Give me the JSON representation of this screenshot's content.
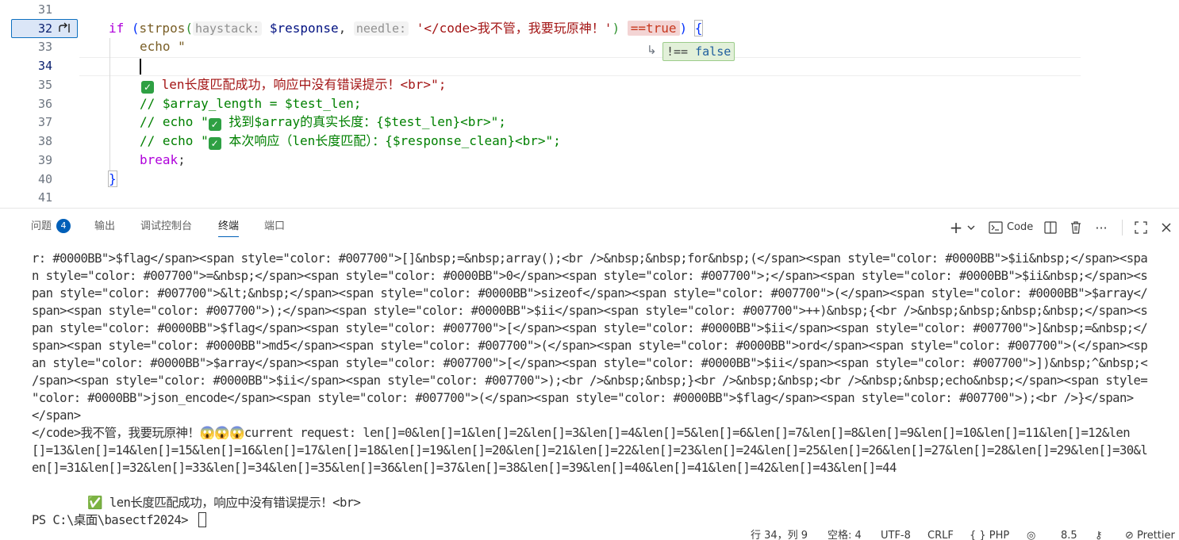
{
  "editor": {
    "line_numbers": [
      "31",
      "32",
      "33",
      "34",
      "35",
      "36",
      "37",
      "38",
      "39",
      "40",
      "41"
    ],
    "active_line": "32",
    "line32": {
      "kw_if": "if",
      "paren_open": " (",
      "fn": "strpos",
      "p1": "(",
      "hint1": "haystack:",
      "var1": "$response",
      "comma": ",",
      "hint2": "needle:",
      "str": "'</code>我不管，我要玩原神！'",
      "p2": ")",
      "deleted": "==true",
      "p3": ")",
      "brace": "{"
    },
    "inline_diff_added": {
      "op": "!==",
      "value": "false"
    },
    "line33": "echo \"",
    "line35_text": " len长度匹配成功，响应中没有错误提示！<br>\";",
    "line36": "// $array_length = $test_len;",
    "line37_a": "// echo \"",
    "line37_b": " 找到$array的真实长度：{$test_len}<br>\";",
    "line38_a": "// echo \"",
    "line38_b": " 本次响应（len长度匹配）：{$response_clean}<br>\";",
    "line39_kw": "break",
    "line39_semi": ";",
    "line40": "}"
  },
  "panel": {
    "tabs": [
      {
        "label": "问题",
        "badge": "4"
      },
      {
        "label": "输出"
      },
      {
        "label": "调试控制台"
      },
      {
        "label": "终端"
      },
      {
        "label": "端口"
      }
    ],
    "active_tab": "终端",
    "toolbar": {
      "add": "+",
      "code_label": "Code"
    },
    "terminal_lines": [
      "r: #0000BB\">$flag</span><span style=\"color: #007700\">[]&nbsp;=&nbsp;array();<br />&nbsp;&nbsp;for&nbsp;(</span><span style=\"color: #0000BB\">$ii&nbsp;</span><spa",
      "n style=\"color: #007700\">=&nbsp;</span><span style=\"color: #0000BB\">0</span><span style=\"color: #007700\">;</span><span style=\"color: #0000BB\">$ii&nbsp;</span><s",
      "pan style=\"color: #007700\">&lt;&nbsp;</span><span style=\"color: #0000BB\">sizeof</span><span style=\"color: #007700\">(</span><span style=\"color: #0000BB\">$array</",
      "span><span style=\"color: #007700\">);</span><span style=\"color: #0000BB\">$ii</span><span style=\"color: #007700\">++)&nbsp;{<br />&nbsp;&nbsp;&nbsp;&nbsp;</span><s",
      "pan style=\"color: #0000BB\">$flag</span><span style=\"color: #007700\">[</span><span style=\"color: #0000BB\">$ii</span><span style=\"color: #007700\">]&nbsp;=&nbsp;</",
      "span><span style=\"color: #0000BB\">md5</span><span style=\"color: #007700\">(</span><span style=\"color: #0000BB\">ord</span><span style=\"color: #007700\">(</span><sp",
      "an style=\"color: #0000BB\">$array</span><span style=\"color: #007700\">[</span><span style=\"color: #0000BB\">$ii</span><span style=\"color: #007700\">])&nbsp;^&nbsp;<",
      "/span><span style=\"color: #0000BB\">$ii</span><span style=\"color: #007700\">);<br />&nbsp;&nbsp;}<br />&nbsp;&nbsp;<br />&nbsp;&nbsp;echo&nbsp;</span><span style=",
      "\"color: #0000BB\">json_encode</span><span style=\"color: #007700\">(</span><span style=\"color: #0000BB\">$flag</span><span style=\"color: #007700\">);<br />}</span>",
      "</span>",
      "</code>我不管，我要玩原神！😱😱😱current request: len[]=0&len[]=1&len[]=2&len[]=3&len[]=4&len[]=5&len[]=6&len[]=7&len[]=8&len[]=9&len[]=10&len[]=11&len[]=12&len",
      "[]=13&len[]=14&len[]=15&len[]=16&len[]=17&len[]=18&len[]=19&len[]=20&len[]=21&len[]=22&len[]=23&len[]=24&len[]=25&len[]=26&len[]=27&len[]=28&len[]=29&len[]=30&l",
      "en[]=31&len[]=32&len[]=33&len[]=34&len[]=35&len[]=36&len[]=37&len[]=38&len[]=39&len[]=40&len[]=41&len[]=42&len[]=43&len[]=44",
      "",
      "        ✅ len长度匹配成功，响应中没有错误提示！<br>"
    ],
    "prompt": "PS C:\\桌面\\basectf2024> "
  },
  "statusbar": {
    "position": "行 34，列 9",
    "spaces": "空格: 4",
    "encoding": "UTF-8",
    "eol": "CRLF",
    "language": "{ } PHP",
    "version": "8.5",
    "prettier": "Prettier"
  },
  "colors": {
    "accent": "#005fb8",
    "keyword": "#0000ff",
    "string": "#a31515",
    "comment": "#008000",
    "check": "#2ea043"
  }
}
